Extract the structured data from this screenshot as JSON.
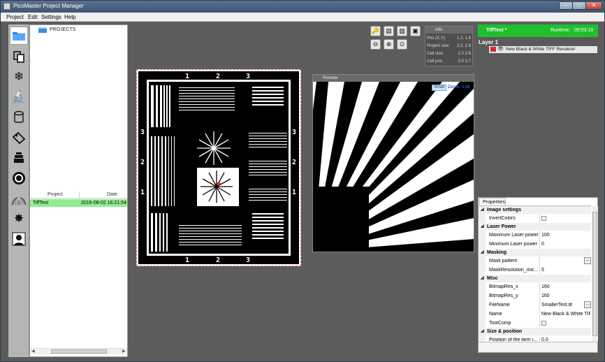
{
  "window": {
    "title": "PicoMaster Project Manager"
  },
  "menu": {
    "items": [
      "Project",
      "Edit",
      "Settings",
      "Help"
    ]
  },
  "toolbar_left": {
    "tools": [
      "folder-icon",
      "copy-icon",
      "snowflake-icon",
      "microscope-icon",
      "cylinder-icon",
      "tag-icon",
      "stack-icon",
      "target-icon",
      "mesh-icon",
      "sun-icon",
      "person-icon"
    ]
  },
  "projects": {
    "header_label": "PROJECTS",
    "columns": [
      "Project",
      "Date"
    ],
    "rows": [
      {
        "project": "TiffTest",
        "date": "2016-08-02 16:21:54"
      }
    ]
  },
  "info": {
    "title": "Info",
    "rows": [
      {
        "label": "Pos (X,Y):",
        "value": "1.2, 1.6"
      },
      {
        "label": "Project size:",
        "value": "2.2, 2.6"
      },
      {
        "label": "Cell size:",
        "value": "2.2  2.6"
      },
      {
        "label": "Cell pos:",
        "value": "0.0  3.7"
      }
    ]
  },
  "preview": {
    "title": "Preview",
    "size_button": "Small",
    "zoom": "Zoom: 1.00"
  },
  "target_labels": {
    "nums": [
      "1",
      "2",
      "3"
    ]
  },
  "layer_panel": {
    "project_name": "TiffTest",
    "project_marker": "*",
    "runtime_label": "Runtime:",
    "runtime_value": "00:53:18",
    "layer_title": "Layer 1",
    "layer_item": "New Black & White TIFF Renderer"
  },
  "properties": {
    "tab": "Properties",
    "categories": [
      {
        "name": "Image settings",
        "rows": [
          {
            "name": "InvertColors",
            "type": "checkbox"
          }
        ]
      },
      {
        "name": "Laser Power",
        "rows": [
          {
            "name": "Maximum Laser power",
            "value": "100"
          },
          {
            "name": "Minimum Laser power",
            "value": "0"
          }
        ]
      },
      {
        "name": "Masking",
        "rows": [
          {
            "name": "Mask pattern",
            "value": "",
            "ellipsis": true
          },
          {
            "name": "MaskResolution_mic...",
            "value": "5"
          }
        ]
      },
      {
        "name": "Misc",
        "rows": [
          {
            "name": "BitmapRes_x",
            "value": "160"
          },
          {
            "name": "BitmapRes_y",
            "value": "160"
          },
          {
            "name": "FileName",
            "value": "SmallerTest.tif",
            "ellipsis": true
          },
          {
            "name": "Name",
            "value": "New Black & White TIF"
          },
          {
            "name": "ToolComp",
            "type": "checkbox"
          }
        ]
      },
      {
        "name": "Size & position",
        "rows": [
          {
            "name": "Position of the item i...",
            "value": "0.0"
          }
        ]
      }
    ]
  },
  "colors": {
    "accent_green": "#1fbf2e",
    "selected_row": "#90ee90",
    "titlebar": "#4a6282"
  }
}
